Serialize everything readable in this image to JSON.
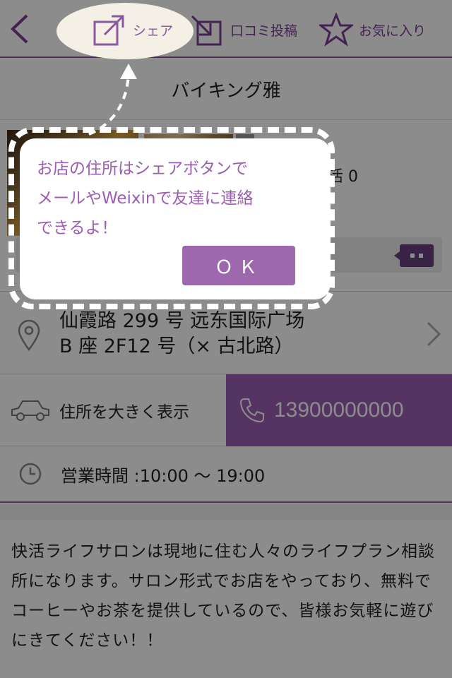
{
  "toolbar": {
    "share_label": "シェア",
    "review_label": "口コミ投稿",
    "favorite_label": "お気に入り"
  },
  "shop": {
    "title": "バイキング雅",
    "rating_fragment": "活 0"
  },
  "address": {
    "line1": "仙霞路 299 号 远东国际广场",
    "line2": "B 座 2F12 号（× 古北路）"
  },
  "actions": {
    "big_map_label": "住所を大きく表示",
    "phone_number": "13900000000"
  },
  "hours": {
    "text": "営業時間 :10:00 〜 19:00"
  },
  "description": "快活ライフサロンは現地に住む人々のライフプラン相談所になります。サロン形式でお店をやっており、無料でコーヒーやお茶を提供しているので、皆様お気軽に遊びにきてください！！",
  "tip": {
    "message": "お店の住所はシェアボタンで\nメールやWeixinで友達に連絡\nできるよ！",
    "ok_label": "ＯＫ"
  },
  "colors": {
    "accent": "#9b5fb6",
    "accent_dark": "#6a3d80",
    "tip_text": "#9c5db2"
  }
}
